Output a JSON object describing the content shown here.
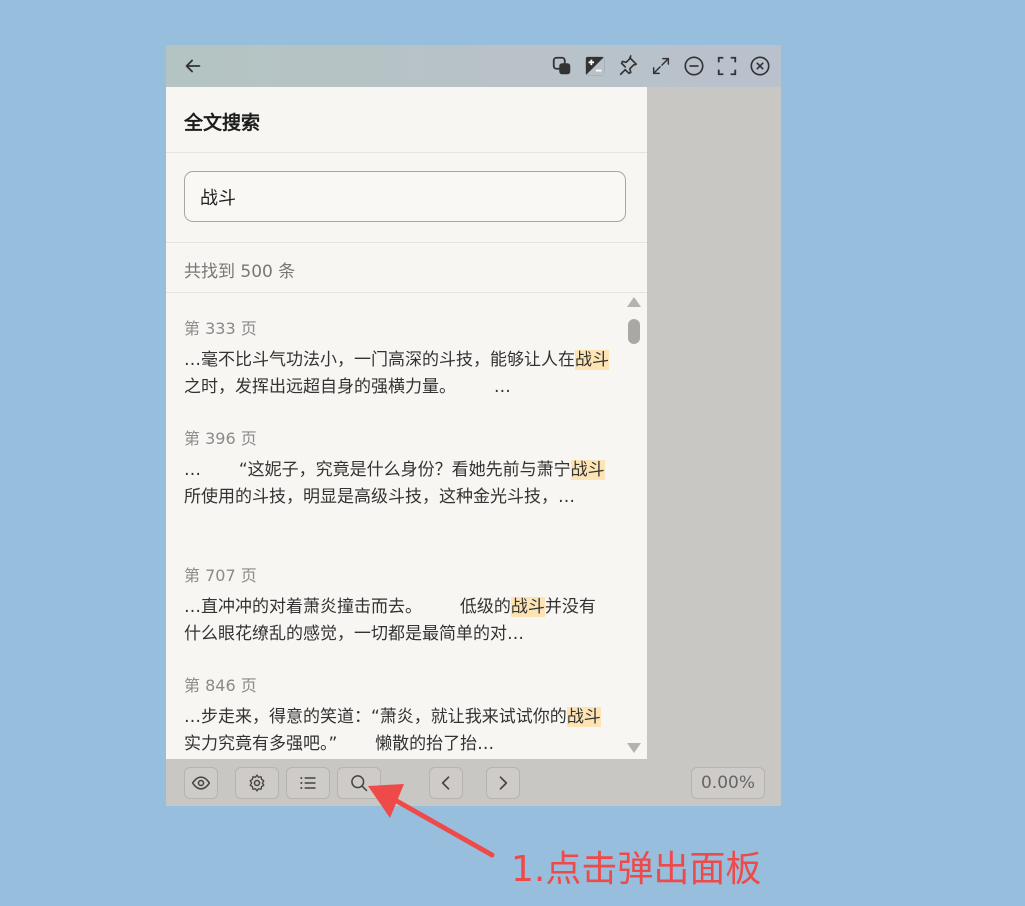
{
  "panel": {
    "title": "全文搜索",
    "search_value": "战斗",
    "result_count": "共找到 500 条",
    "results": [
      {
        "page": "第 333 页",
        "before": "…毫不比斗气功法小，一门高深的斗技，能够让人在",
        "highlight": "战斗",
        "after": "之时，发挥出远超自身的强横力量。       …"
      },
      {
        "page": "第 396 页",
        "before": "…       “这妮子，究竟是什么身份？看她先前与萧宁",
        "highlight": "战斗",
        "after": "所使用的斗技，明显是高级斗技，这种金光斗技，…"
      },
      {
        "page": "第 707 页",
        "before": "…直冲冲的对着萧炎撞击而去。       低级的",
        "highlight": "战斗",
        "after": "并没有什么眼花缭乱的感觉，一切都是最简单的对…"
      },
      {
        "page": "第 846 页",
        "before": "…步走来，得意的笑道：“萧炎，就让我来试试你的",
        "highlight": "战斗",
        "after": "实力究竟有多强吧。”       懒散的抬了抬…"
      }
    ]
  },
  "titlebar": {
    "icons": [
      "back-arrow-icon",
      "copy-icon",
      "contrast-icon",
      "pin-icon",
      "expand-icon",
      "minimize-icon",
      "fullscreen-icon",
      "close-icon"
    ]
  },
  "bottombar": {
    "zoom": "0.00%",
    "icons": [
      "eye-icon",
      "gear-icon",
      "list-icon",
      "search-icon",
      "chevron-left-icon",
      "chevron-right-icon"
    ]
  },
  "annotation": {
    "text": "1.点击弹出面板",
    "color": "#ef4a4a"
  },
  "colors": {
    "desktop": "#97bfdd",
    "highlight": "#fde4b4",
    "panel": "#f7f6f2"
  }
}
